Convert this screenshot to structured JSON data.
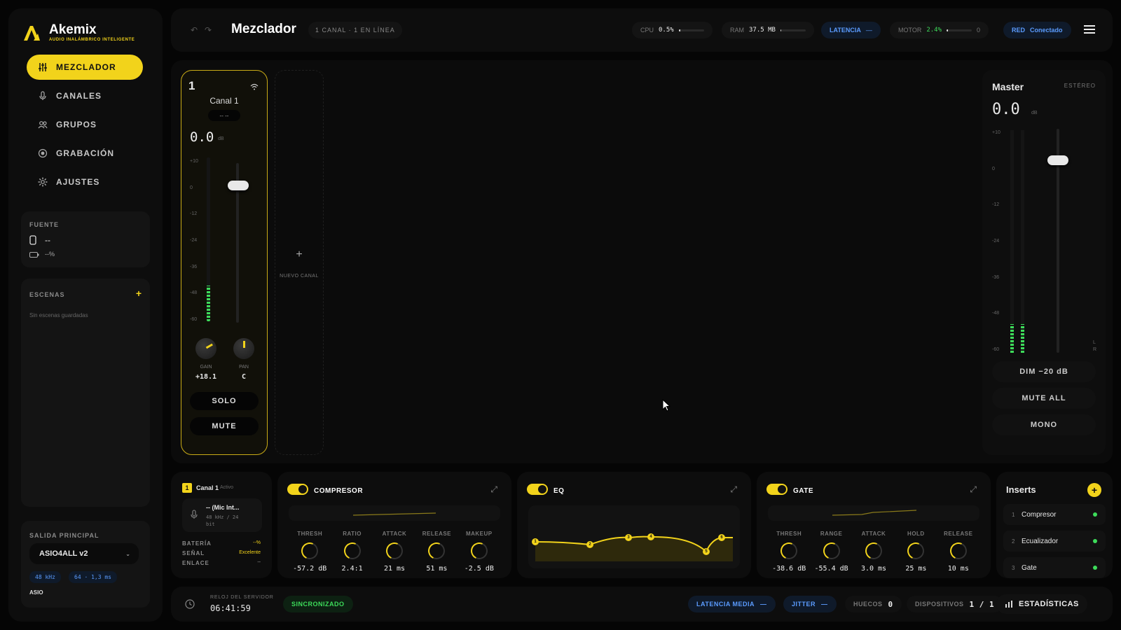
{
  "app": {
    "name": "Akemix",
    "tagline": "AUDIO INALÁMBRICO INTELIGENTE",
    "accent": "#f2d31b"
  },
  "sidebar": {
    "items": [
      {
        "label": "MEZCLADOR",
        "icon": "sliders-icon",
        "active": true
      },
      {
        "label": "CANALES",
        "icon": "microphone-icon"
      },
      {
        "label": "GRUPOS",
        "icon": "users-icon"
      },
      {
        "label": "GRABACIÓN",
        "icon": "record-icon"
      },
      {
        "label": "AJUSTES",
        "icon": "gear-icon"
      }
    ],
    "source": {
      "title": "FUENTE",
      "device": "--",
      "battery": "--%"
    },
    "scenes": {
      "title": "ESCENAS",
      "add": "+",
      "empty": "Sin escenas guardadas"
    },
    "output": {
      "title": "SALIDA PRINCIPAL",
      "device": "ASIO4ALL v2",
      "rate": "48 kHz",
      "buffer": "64 · 1,3 ms",
      "driver": "ASIO"
    }
  },
  "topbar": {
    "title": "Mezclador",
    "subtitle": "1 CANAL · 1 EN LÍNEA",
    "cpu": {
      "label": "CPU",
      "value": "0.5%",
      "level": 0.05
    },
    "ram": {
      "label": "RAM",
      "value": "37.5 MB",
      "level": 0.04
    },
    "latency": {
      "label": "LATENCIA",
      "value": "—"
    },
    "motor": {
      "label": "MOTOR",
      "value": "2.4%",
      "level": 0.05,
      "count": "0"
    },
    "network": {
      "label": "RED",
      "value": "Conectado"
    }
  },
  "channel": {
    "number": "1",
    "name": "Canal 1",
    "input": "-- --",
    "gain_db": "0.0",
    "db_unit": "dB",
    "scale": [
      "+10",
      "0",
      "-12",
      "-24",
      "-36",
      "-48",
      "-60"
    ],
    "fader_level": 0.86,
    "meter_level": 0.22,
    "gain_label": "GAIN",
    "gain_value": "+18.1",
    "pan_label": "PAN",
    "pan_value": "C",
    "solo": "SOLO",
    "mute": "MUTE"
  },
  "new_channel": {
    "icon": "+",
    "label": "NUEVO CANAL"
  },
  "master": {
    "title": "Master",
    "mode": "ESTÉREO",
    "gain_db": "0.0",
    "db_unit": "dB",
    "scale": [
      "+10",
      "0",
      "-12",
      "-24",
      "-36",
      "-48",
      "-60"
    ],
    "fader_level": 0.86,
    "meter_level": 0.13,
    "lr": [
      "L",
      "R"
    ],
    "dim": "DIM −20 dB",
    "mute_all": "MUTE ALL",
    "mono": "MONO"
  },
  "channel_info": {
    "number": "1",
    "name": "Canal 1",
    "state": "Activo",
    "device": "-- (Mic Int...",
    "format": "48 kHz / 24 bit",
    "battery_label": "BATERÍA",
    "battery_value": "--%",
    "signal_label": "SEÑAL",
    "signal_value": "Excelente",
    "link_label": "ENLACE",
    "link_value": "--"
  },
  "compressor": {
    "title": "COMPRESOR",
    "params": [
      {
        "label": "THRESH",
        "value": "-57.2 dB"
      },
      {
        "label": "RATIO",
        "value": "2.4:1"
      },
      {
        "label": "ATTACK",
        "value": "21 ms"
      },
      {
        "label": "RELEASE",
        "value": "51 ms"
      },
      {
        "label": "MAKEUP",
        "value": "-2.5 dB"
      }
    ]
  },
  "eq": {
    "title": "EQ",
    "bands": [
      "1",
      "2",
      "3",
      "4",
      "5",
      "6"
    ]
  },
  "gate": {
    "title": "GATE",
    "params": [
      {
        "label": "THRESH",
        "value": "-38.6 dB"
      },
      {
        "label": "RANGE",
        "value": "-55.4 dB"
      },
      {
        "label": "ATTACK",
        "value": "3.0 ms"
      },
      {
        "label": "HOLD",
        "value": "25 ms"
      },
      {
        "label": "RELEASE",
        "value": "10 ms"
      }
    ]
  },
  "inserts": {
    "title": "Inserts",
    "add": "+",
    "items": [
      {
        "n": "1",
        "name": "Compresor"
      },
      {
        "n": "2",
        "name": "Ecualizador"
      },
      {
        "n": "3",
        "name": "Gate"
      }
    ]
  },
  "footer": {
    "clock_label": "RELOJ DEL SERVIDOR",
    "clock": "06:41:59",
    "sync": "SINCRONIZADO",
    "latency_label": "LATENCIA MEDIA",
    "latency_value": "—",
    "jitter_label": "JITTER",
    "jitter_value": "—",
    "gaps_label": "HUECOS",
    "gaps_value": "0",
    "devices_label": "DISPOSITIVOS",
    "devices_value": "1 / 1",
    "stats": "ESTADÍSTICAS"
  }
}
